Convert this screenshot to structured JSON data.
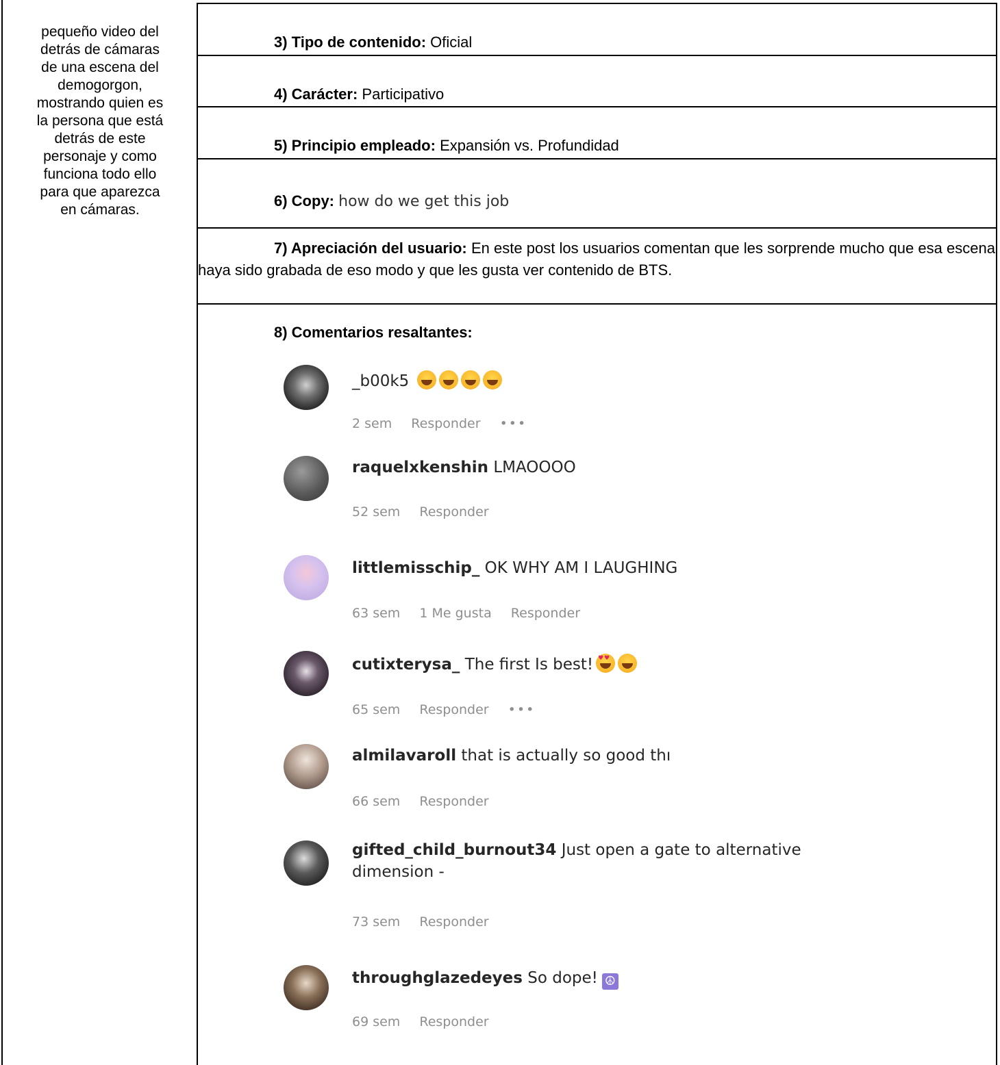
{
  "left_column": {
    "line1": "pequeño video del",
    "line2": "detrás de cámaras",
    "line3": "de una escena del",
    "line4": "demogorgon,",
    "line5": "mostrando quien es",
    "line6": "la persona que está",
    "line7": "detrás de este",
    "line8": "personaje y como",
    "line9": "funciona todo ello",
    "line10": "para que aparezca",
    "line11": "en cámaras."
  },
  "rows": {
    "content_type": {
      "label": "3) Tipo de contenido:",
      "value": "Oficial"
    },
    "character": {
      "label": "4) Carácter:",
      "value": "Participativo"
    },
    "principle": {
      "label": "5) Principio empleado:",
      "value": "Expansión vs. Profundidad"
    },
    "copy": {
      "label": "6) Copy:",
      "value": "how do we get this job"
    },
    "appreciation": {
      "label": "7) Apreciación del usuario:",
      "value": "En este post los usuarios comentan que les sorprende mucho que esa escena haya sido grabada de eso modo y que les gusta ver contenido de BTS."
    },
    "comments_heading": "8) Comentarios resaltantes:"
  },
  "comments": [
    {
      "user": "_b00k5",
      "text": "",
      "emoji": [
        "grin",
        "grin",
        "grin",
        "grin"
      ],
      "age": "2 sem",
      "likes": "",
      "reply": "Responder",
      "more": "•••"
    },
    {
      "user": "raquelxkenshin",
      "text": "LMAOOOO",
      "emoji": [],
      "age": "52 sem",
      "likes": "",
      "reply": "Responder",
      "more": ""
    },
    {
      "user": "littlemisschip_",
      "text": "OK WHY AM I LAUGHING",
      "emoji": [],
      "age": "63 sem",
      "likes": "1 Me gusta",
      "reply": "Responder",
      "more": ""
    },
    {
      "user": "cutixterysa_",
      "text": "The first Is best!",
      "emoji": [
        "heart-eyes",
        "grin"
      ],
      "age": "65 sem",
      "likes": "",
      "reply": "Responder",
      "more": "•••"
    },
    {
      "user": "almilavaroll",
      "text": "that is actually so good thı",
      "emoji": [],
      "age": "66 sem",
      "likes": "",
      "reply": "Responder",
      "more": ""
    },
    {
      "user": "gifted_child_burnout34",
      "text": "Just open a gate to alternative",
      "text2": "dimension -",
      "emoji": [],
      "age": "73 sem",
      "likes": "",
      "reply": "Responder",
      "more": ""
    },
    {
      "user": "throughglazedeyes",
      "text": "So dope!",
      "emoji": [
        "peace"
      ],
      "age": "69 sem",
      "likes": "",
      "reply": "Responder",
      "more": ""
    }
  ],
  "colors": {
    "border": "#000000",
    "username": "#262626",
    "meta": "#8e8e8e",
    "avatar_fills": [
      "#4a4a4a",
      "#6b6b6b",
      "#c8b6e8",
      "#3a2d3a",
      "#8a7a70",
      "#2a2a2a",
      "#5a4a3a"
    ]
  }
}
